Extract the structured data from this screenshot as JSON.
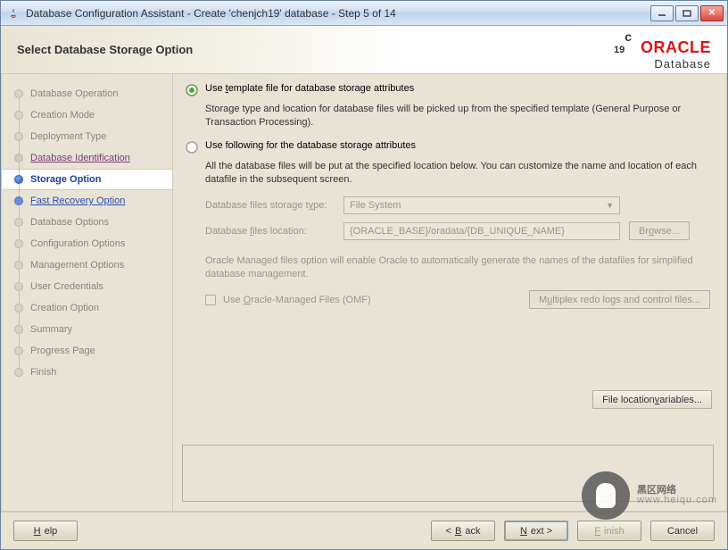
{
  "window": {
    "title": "Database Configuration Assistant - Create 'chenjch19' database - Step 5 of 14"
  },
  "header": {
    "title": "Select Database Storage Option",
    "brand_version": "19",
    "brand_version_sup": "c",
    "brand_word": "ORACLE",
    "brand_sub": "Database"
  },
  "steps": [
    {
      "label": "Database Operation",
      "state": "past"
    },
    {
      "label": "Creation Mode",
      "state": "past"
    },
    {
      "label": "Deployment Type",
      "state": "past"
    },
    {
      "label": "Database Identification",
      "state": "visited"
    },
    {
      "label": "Storage Option",
      "state": "current"
    },
    {
      "label": "Fast Recovery Option",
      "state": "next"
    },
    {
      "label": "Database Options",
      "state": "future"
    },
    {
      "label": "Configuration Options",
      "state": "future"
    },
    {
      "label": "Management Options",
      "state": "future"
    },
    {
      "label": "User Credentials",
      "state": "future"
    },
    {
      "label": "Creation Option",
      "state": "future"
    },
    {
      "label": "Summary",
      "state": "future"
    },
    {
      "label": "Progress Page",
      "state": "future"
    },
    {
      "label": "Finish",
      "state": "future"
    }
  ],
  "content": {
    "opt1_prefix": "Use ",
    "opt1_u": "t",
    "opt1_rest": "emplate file for database storage attributes",
    "opt1_desc": "Storage type and location for database files will be picked up from the specified template (General Purpose or Transaction Processing).",
    "opt2_label": "Use following for the database storage attributes",
    "opt2_desc": "All the database files will be put at the specified location below. You can customize the name and location of each datafile in the subsequent screen.",
    "storage_type_pre": "Database files storage t",
    "storage_type_u": "y",
    "storage_type_post": "pe:",
    "storage_type_value": "File System",
    "files_loc_pre": "Database ",
    "files_loc_u": "f",
    "files_loc_post": "iles location:",
    "files_loc_value": "{ORACLE_BASE}/oradata/{DB_UNIQUE_NAME}",
    "browse_pre": "Br",
    "browse_u": "o",
    "browse_post": "wse...",
    "omf_desc": "Oracle Managed files option will enable Oracle to automatically generate the names of the datafiles for simplified database management.",
    "omf_pre": "Use ",
    "omf_u": "O",
    "omf_post": "racle-Managed Files (OMF)",
    "mux_pre": "M",
    "mux_u": "u",
    "mux_post": "ltiplex redo logs and control files...",
    "flv_pre": "File location ",
    "flv_u": "v",
    "flv_post": "ariables..."
  },
  "footer": {
    "help_u": "H",
    "help_post": "elp",
    "back_lt": "< ",
    "back_u": "B",
    "back_post": "ack",
    "next_u": "N",
    "next_post": "ext >",
    "finish_u": "F",
    "finish_post": "inish",
    "cancel": "Cancel"
  },
  "watermark": {
    "main": "黑区网络",
    "sub": "www.heiqu.com"
  }
}
